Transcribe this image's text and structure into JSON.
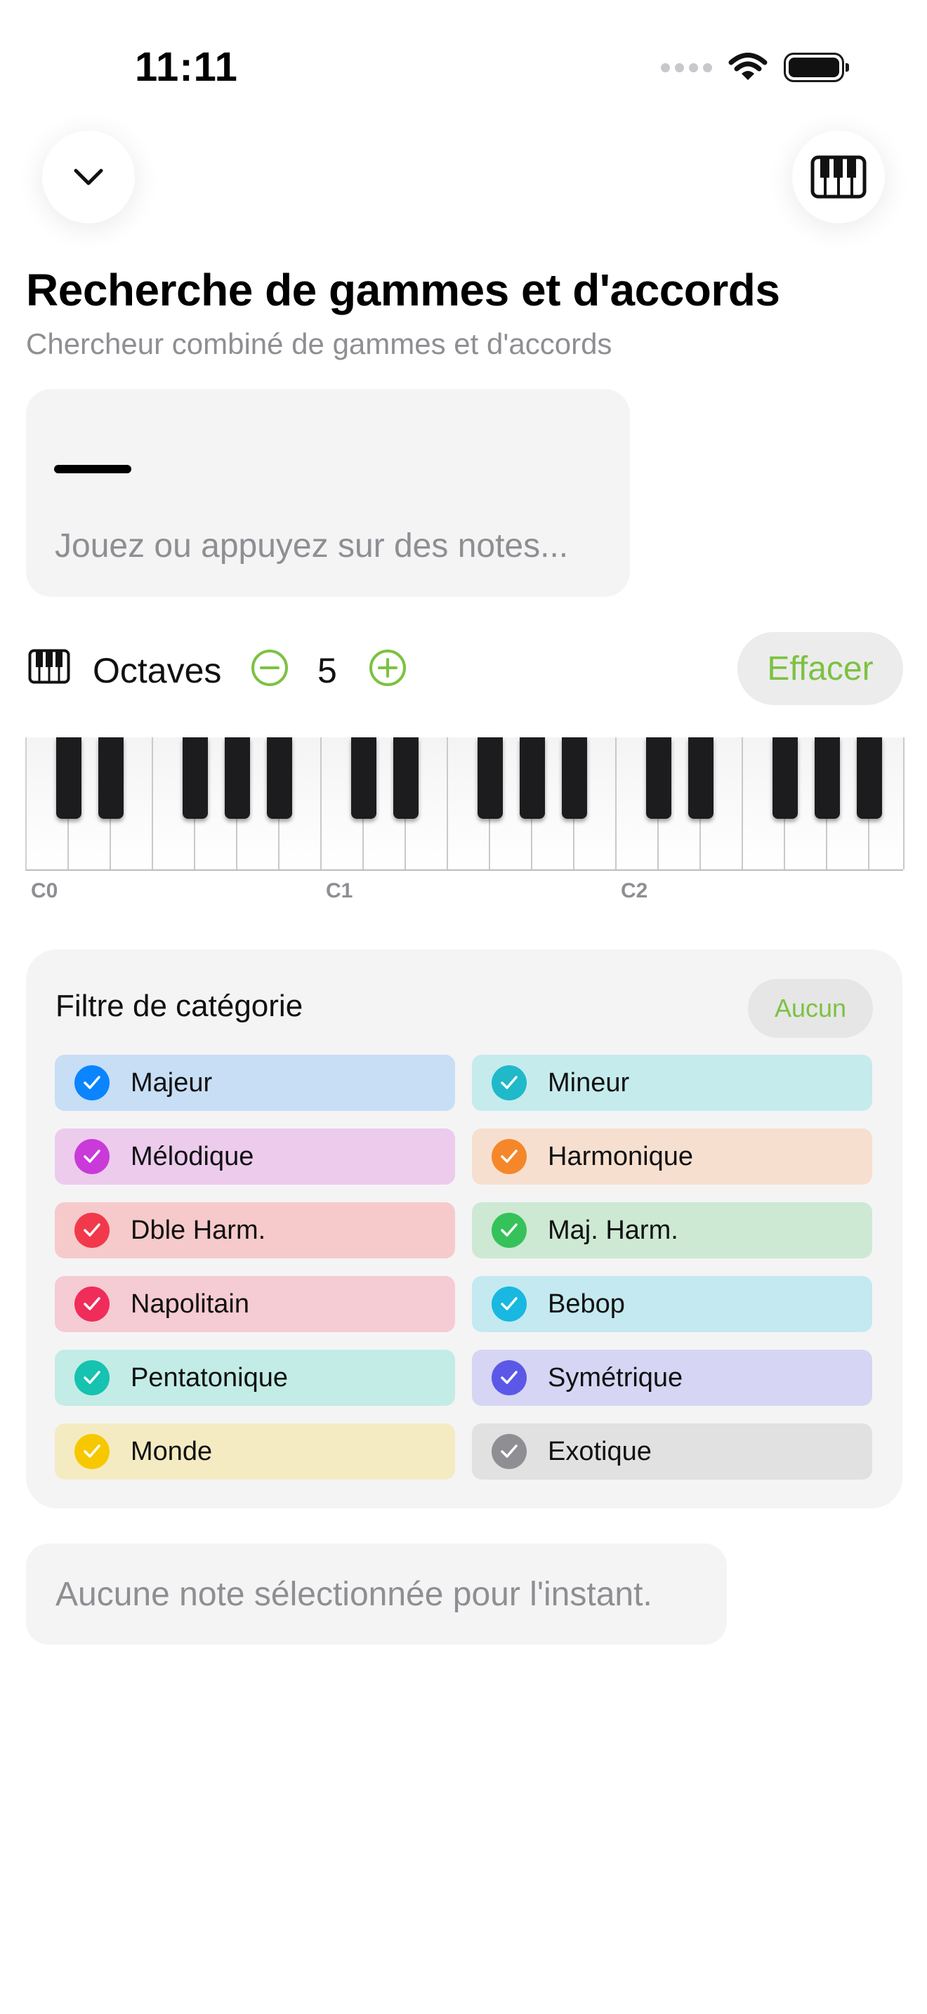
{
  "status_bar": {
    "time": "11:11"
  },
  "header": {
    "title": "Recherche de gammes et d'accords",
    "subtitle": "Chercheur combiné de gammes et d'accords"
  },
  "notes_input": {
    "placeholder": "Jouez ou appuyez sur des notes..."
  },
  "octaves": {
    "label": "Octaves",
    "value": "5",
    "clear_label": "Effacer"
  },
  "piano": {
    "octave_labels": [
      "C0",
      "C1",
      "C2"
    ]
  },
  "category_filter": {
    "title": "Filtre de catégorie",
    "none_label": "Aucun",
    "categories": [
      {
        "label": "Majeur",
        "color": "#0a84ff",
        "bg": "#c7def5",
        "checked": true
      },
      {
        "label": "Mineur",
        "color": "#1fb9c9",
        "bg": "#c5ebed",
        "checked": true
      },
      {
        "label": "Mélodique",
        "color": "#c93ad9",
        "bg": "#eccbed",
        "checked": true
      },
      {
        "label": "Harmonique",
        "color": "#f5872a",
        "bg": "#f7dfcf",
        "checked": true
      },
      {
        "label": "Dble Harm.",
        "color": "#f2394b",
        "bg": "#f6cacb",
        "checked": true
      },
      {
        "label": "Maj. Harm.",
        "color": "#35c25a",
        "bg": "#cde9d3",
        "checked": true
      },
      {
        "label": "Napolitain",
        "color": "#f02c5a",
        "bg": "#f5cbd4",
        "checked": true
      },
      {
        "label": "Bebop",
        "color": "#18b8e0",
        "bg": "#c4e9f0",
        "checked": true
      },
      {
        "label": "Pentatonique",
        "color": "#16c2b0",
        "bg": "#c3ece6",
        "checked": true
      },
      {
        "label": "Symétrique",
        "color": "#5b58e8",
        "bg": "#d6d5f3",
        "checked": true
      },
      {
        "label": "Monde",
        "color": "#f7c800",
        "bg": "#f5ebc2",
        "checked": true
      },
      {
        "label": "Exotique",
        "color": "#8e8e93",
        "bg": "#e1e1e1",
        "checked": true
      }
    ]
  },
  "results": {
    "empty_message": "Aucune note sélectionnée pour l'instant."
  },
  "colors": {
    "accent": "#7cc242"
  }
}
